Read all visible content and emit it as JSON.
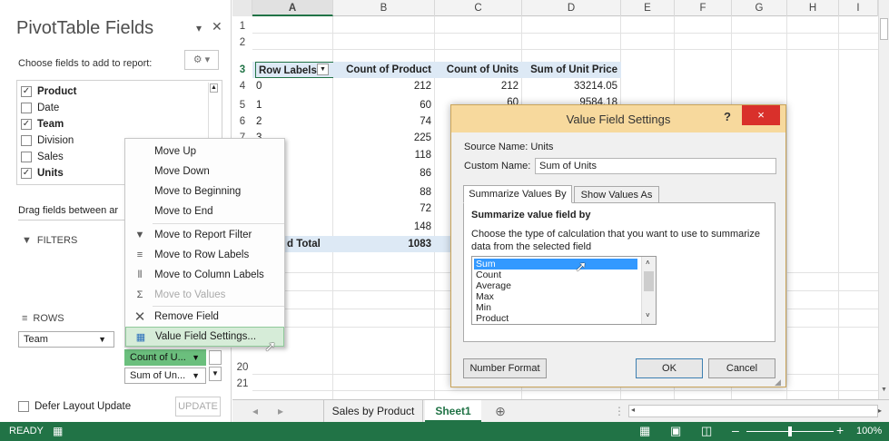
{
  "pane": {
    "title": "PivotTable Fields",
    "choose_label": "Choose fields to add to report:",
    "fields": [
      {
        "label": "Product",
        "checked": true
      },
      {
        "label": "Date",
        "checked": false
      },
      {
        "label": "Team",
        "checked": true
      },
      {
        "label": "Division",
        "checked": false
      },
      {
        "label": "Sales",
        "checked": false
      },
      {
        "label": "Units",
        "checked": true
      }
    ],
    "drag_label": "Drag fields between ar",
    "filters_label": "FILTERS",
    "rows_label": "ROWS",
    "rows_pill": "Team",
    "values_pills": [
      "Count of U...",
      "Sum of Un..."
    ],
    "defer_label": "Defer Layout Update",
    "update_label": "UPDATE"
  },
  "context_menu": {
    "items": [
      {
        "label": "Move Up",
        "enabled": true
      },
      {
        "label": "Move Down",
        "enabled": true
      },
      {
        "label": "Move to Beginning",
        "enabled": true
      },
      {
        "label": "Move to End",
        "enabled": true
      },
      {
        "label": "Move to Report Filter",
        "enabled": true
      },
      {
        "label": "Move to Row Labels",
        "enabled": true
      },
      {
        "label": "Move to Column Labels",
        "enabled": true
      },
      {
        "label": "Move to Values",
        "enabled": false
      },
      {
        "label": "Remove Field",
        "enabled": true
      },
      {
        "label": "Value Field Settings...",
        "enabled": true
      }
    ]
  },
  "sheet": {
    "columns": [
      "A",
      "B",
      "C",
      "D",
      "E",
      "F",
      "G",
      "H",
      "I"
    ],
    "row_numbers": [
      "1",
      "2",
      "3",
      "4",
      "5",
      "6",
      "7",
      "",
      "",
      "",
      "",
      "",
      "",
      "",
      "",
      "",
      "",
      "",
      "19",
      "20",
      "21",
      ""
    ],
    "header": [
      "Row Labels",
      "Count of Product",
      "Count of Units",
      "Sum of Unit Price"
    ],
    "rows": [
      [
        "0",
        "212",
        "212",
        "33214.05"
      ],
      [
        "1",
        "60",
        "60",
        "9584.18"
      ],
      [
        "2",
        "74",
        "",
        ""
      ],
      [
        "3",
        "225",
        "",
        ""
      ],
      [
        "",
        "118",
        "",
        ""
      ],
      [
        "",
        "86",
        "",
        ""
      ],
      [
        "",
        "88",
        "",
        ""
      ],
      [
        "",
        "72",
        "",
        ""
      ],
      [
        "",
        "148",
        "",
        ""
      ]
    ],
    "total_label": "d Total",
    "total_value": "1083"
  },
  "dialog": {
    "title": "Value Field Settings",
    "help": "?",
    "close": "×",
    "source_label": "Source Name:  Units",
    "custom_label": "Custom Name:",
    "custom_value": "Sum of Units",
    "tab_summarize": "Summarize Values By",
    "tab_show": "Show Values As",
    "section_title": "Summarize value field by",
    "description": "Choose the type of calculation that you want to use to summarize data from the selected field",
    "calc_options": [
      "Sum",
      "Count",
      "Average",
      "Max",
      "Min",
      "Product"
    ],
    "selected_option": "Sum",
    "number_format": "Number Format",
    "ok": "OK",
    "cancel": "Cancel"
  },
  "tabs": {
    "sheet1": "Sales by Product",
    "sheet2": "Sheet1",
    "add": "⊕"
  },
  "status": {
    "ready": "READY",
    "zoom": "100%"
  }
}
